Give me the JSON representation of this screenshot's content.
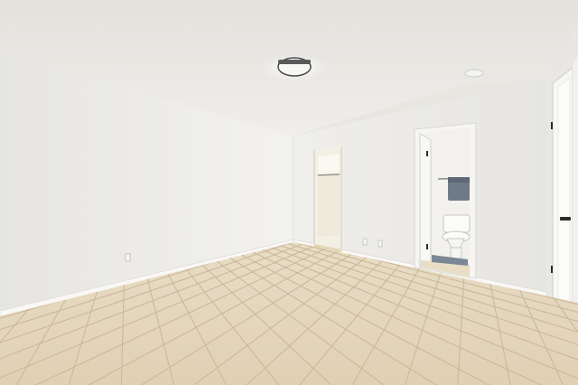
{
  "scene": {
    "description_free": true,
    "colors": {
      "ceiling": "#eceae6",
      "left_wall": "#eeede9",
      "back_wall": "#f1f0ec",
      "right_wall": "#e9e8e4",
      "floor": "#e4d6bd",
      "grout": "#cbb89a",
      "baseboard": "#f7f6f3",
      "door": "#f6f6f4",
      "closet_interior": "#f4efe3",
      "bathroom_wall": "#f3f2ee",
      "towel": "#6f7a86",
      "bath_mat": "#7b8795",
      "hardware": "#2a2a2a"
    }
  }
}
